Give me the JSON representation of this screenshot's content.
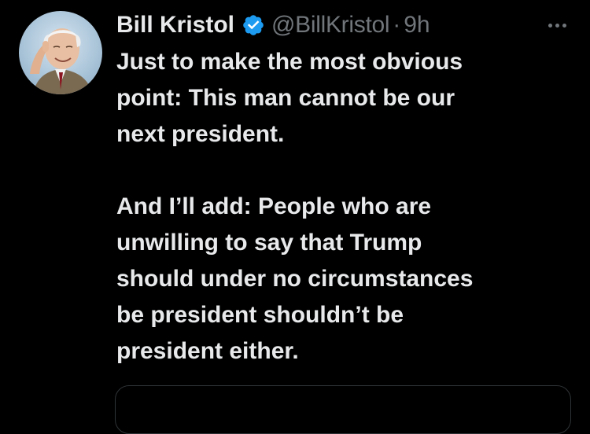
{
  "tweet": {
    "author": {
      "display_name": "Bill Kristol",
      "handle": "@BillKristol",
      "verified_icon": "verified-badge-icon",
      "avatar": "author-avatar"
    },
    "separator": "·",
    "time": "9h",
    "more_icon": "more-options-icon",
    "paragraphs": [
      "Just to make the most obvious\npoint: This man cannot be our\nnext president.",
      "And I’ll add: People who are\nunwilling to say that Trump\nshould under no circumstances\nbe president shouldn’t be\npresident either."
    ]
  },
  "colors": {
    "background": "#000000",
    "text_primary": "#e7e9ea",
    "text_secondary": "#71767b",
    "verified_blue": "#1d9bf0",
    "border": "#2f3336"
  }
}
